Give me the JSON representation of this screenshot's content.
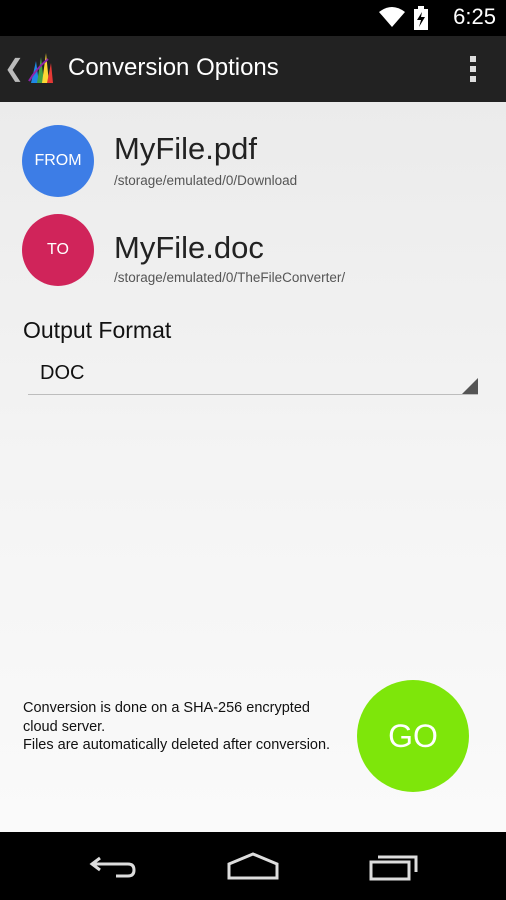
{
  "status_bar": {
    "time": "6:25",
    "icons": [
      "wifi-icon",
      "battery-charging-icon"
    ]
  },
  "action_bar": {
    "title": "Conversion Options",
    "icons": [
      "back-chevron-icon",
      "app-logo-icon",
      "overflow-menu-icon"
    ]
  },
  "from": {
    "badge": "FROM",
    "file_name": "MyFile.pdf",
    "path": "/storage/emulated/0/Download",
    "color": "#3d7de6"
  },
  "to": {
    "badge": "TO",
    "file_name": "MyFile.doc",
    "path": "/storage/emulated/0/TheFileConverter/",
    "color": "#d0245a"
  },
  "output_format": {
    "label": "Output Format",
    "selected": "DOC"
  },
  "info": {
    "line1": "Conversion is done on a SHA-256 encrypted cloud server.",
    "line2": "Files are automatically deleted after conversion."
  },
  "go_button": {
    "label": "GO",
    "color": "#7ee60a"
  },
  "nav_bar": {
    "icons": [
      "back-icon",
      "home-icon",
      "recent-apps-icon"
    ]
  }
}
